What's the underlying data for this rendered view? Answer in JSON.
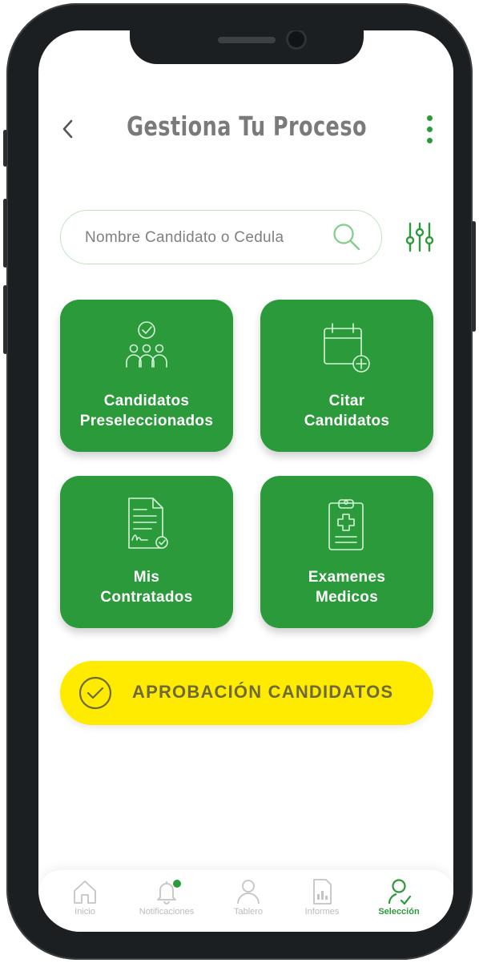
{
  "header": {
    "title": "Gestiona Tu Proceso",
    "back_icon": "chevron-left-icon",
    "menu_icon": "kebab-menu-icon"
  },
  "search": {
    "placeholder": "Nombre Candidato o Cedula",
    "value": "",
    "icon": "search-icon",
    "filter_icon": "filter-sliders-icon"
  },
  "cards": [
    {
      "line1": "Candidatos",
      "line2": "Preseleccionados",
      "icon": "people-check-icon"
    },
    {
      "line1": "Citar",
      "line2": "Candidatos",
      "icon": "calendar-add-icon"
    },
    {
      "line1": "Mis",
      "line2": "Contratados",
      "icon": "contract-signed-icon"
    },
    {
      "line1": "Examenes",
      "line2": "Medicos",
      "icon": "medical-clipboard-icon"
    }
  ],
  "approve_button": {
    "label": "APROBACIÓN CANDIDATOS",
    "icon": "check-circle-icon"
  },
  "tabbar": [
    {
      "label": "Inicio",
      "icon": "home-icon",
      "active": false
    },
    {
      "label": "Notificaciones",
      "icon": "bell-icon",
      "active": false,
      "has_badge": true
    },
    {
      "label": "Tablero",
      "icon": "user-icon",
      "active": false
    },
    {
      "label": "Informes",
      "icon": "report-icon",
      "active": false
    },
    {
      "label": "Selección",
      "icon": "user-check-icon",
      "active": true
    }
  ],
  "colors": {
    "primary_green": "#2a9a3a",
    "accent_yellow": "#ffeb00",
    "title_gray": "#7a7a7a"
  }
}
